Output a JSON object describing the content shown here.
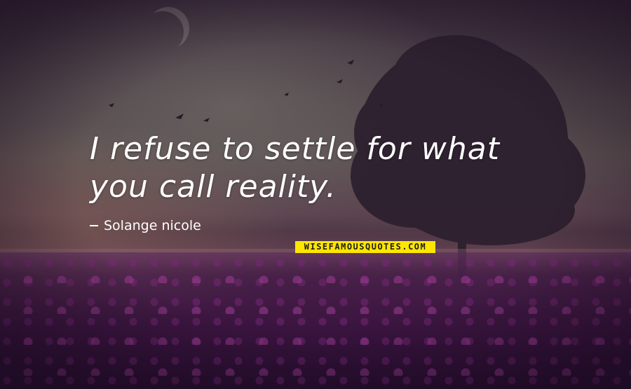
{
  "quote": {
    "line1": "I refuse to settle for what",
    "line2": "you call reality."
  },
  "author": {
    "name": "Solange nicole"
  },
  "watermark": {
    "text": "WISEFAMOUSQUOTES.COM"
  },
  "colors": {
    "quote_text": "#ffffff",
    "watermark_bg": "#ffe600",
    "watermark_text": "#1d1d1d"
  }
}
